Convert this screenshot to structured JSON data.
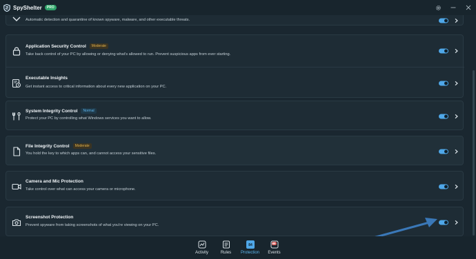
{
  "app": {
    "name": "SpyShelter",
    "badge": "PRO"
  },
  "rows": [
    {
      "title": "",
      "desc": "Automatic detection and quarantine of known spyware, malware, and other executable threats.",
      "badge": "",
      "icon": "check-icon",
      "toggle_on": true
    },
    {
      "title": "Application Security Control",
      "desc": "Take back control of your PC by allowing or denying what's allowed to run. Prevent suspicious apps from ever starting.",
      "badge": "Moderate",
      "icon": "lock-icon",
      "toggle_on": true
    },
    {
      "title": "Executable Insights",
      "desc": "Get instant access to critical information about every new application on your PC.",
      "badge": "",
      "icon": "executable-insights-icon",
      "toggle_on": true
    },
    {
      "title": "System Integrity Control",
      "desc": "Protect your PC by controlling what Windows services you want to allow.",
      "badge": "Normal",
      "icon": "tools-icon",
      "toggle_on": true
    },
    {
      "title": "File Integrity Control",
      "desc": "You hold the key to which apps can, and cannot access your sensitive files.",
      "badge": "Moderate",
      "icon": "file-icon",
      "toggle_on": true
    },
    {
      "title": "Camera and Mic Protection",
      "desc": "Take control over what can access your camera or microphone.",
      "badge": "",
      "icon": "camera-video-icon",
      "toggle_on": true
    },
    {
      "title": "Screenshot Protection",
      "desc": "Prevent spyware from taking screenshots of what you're viewing on your PC.",
      "badge": "",
      "icon": "camera-icon",
      "toggle_on": true
    }
  ],
  "nav": [
    {
      "label": "Activity",
      "icon": "activity-icon"
    },
    {
      "label": "Rules",
      "icon": "rules-icon"
    },
    {
      "label": "Protection",
      "icon": "protection-icon",
      "active": true
    },
    {
      "label": "Events",
      "icon": "events-icon",
      "count": "99"
    }
  ],
  "colors": {
    "accent": "#4fa7e8",
    "background": "#1a2730",
    "card": "#1e2c35",
    "moderate": "#e3b24a",
    "normal": "#5fb7f0",
    "annotation_arrow": "#3a78b8"
  }
}
